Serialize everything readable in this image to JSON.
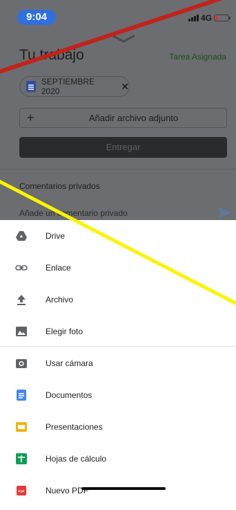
{
  "status_bar": {
    "time": "9:04",
    "network": "4G"
  },
  "assignment": {
    "title": "Tu trabajo",
    "status": "Tarea Asignada",
    "attached_file": "SEPTIEMBRE 2020",
    "add_attachment_label": "Añadir archivo adjunto",
    "submit_label": "Entregar",
    "comments_title": "Comentarios privados",
    "comment_placeholder": "Añade un comentario privado"
  },
  "sheet": {
    "items": [
      {
        "label": "Drive",
        "icon": "drive-icon"
      },
      {
        "label": "Enlace",
        "icon": "link-icon"
      },
      {
        "label": "Archivo",
        "icon": "upload-icon"
      },
      {
        "label": "Elegir foto",
        "icon": "photo-icon"
      },
      {
        "label": "Usar cámara",
        "icon": "camera-icon"
      },
      {
        "label": "Documentos",
        "icon": "docs-icon"
      },
      {
        "label": "Presentaciones",
        "icon": "slides-icon"
      },
      {
        "label": "Hojas de cálculo",
        "icon": "sheets-icon"
      },
      {
        "label": "Nuevo PDF",
        "icon": "pdf-icon"
      }
    ]
  },
  "colors": {
    "time_pill": "#2f6fe0",
    "assigned_status": "#1e4d1e",
    "docs": "#4285f4",
    "slides": "#f4b400",
    "sheets": "#0f9d58",
    "pdf": "#e53935",
    "annotation_red": "#c0231c",
    "annotation_yellow": "#f8f500"
  }
}
